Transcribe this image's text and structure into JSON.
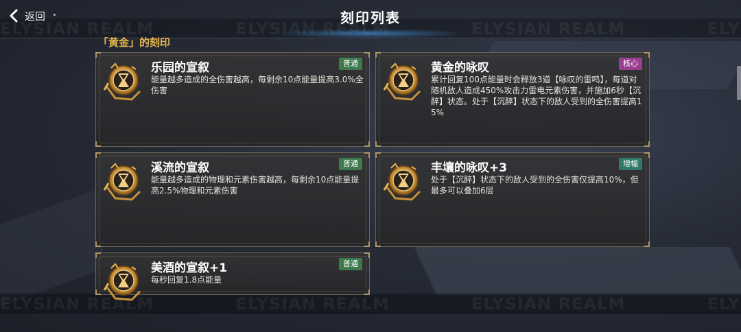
{
  "header": {
    "back_label": "返回",
    "title": "刻印列表"
  },
  "watermark": {
    "text": "ELYSIAN REALM"
  },
  "section": {
    "label": "「黄金」的刻印"
  },
  "colors": {
    "accent_gold": "#e8b64c",
    "badge_normal": "#3f7a4e",
    "badge_core": "#9a3f8f",
    "badge_boost": "#2f7a6a"
  },
  "cards": [
    {
      "name": "乐园的宣叙",
      "badge": "普通",
      "badge_type": "normal",
      "icon": "hourglass-cup-emblem-icon",
      "desc": "能量越多造成的全伤害越高，每剩余10点能量提高3.0%全伤害"
    },
    {
      "name": "黄金的咏叹",
      "badge": "核心",
      "badge_type": "core",
      "icon": "hourglass-cup-emblem-icon",
      "desc": "累计回复100点能量时会释放3道【咏叹的雷鸣】，每道对随机敌人造成450%攻击力雷电元素伤害，并施加6秒【沉醉】状态。处于【沉醉】状态下的敌人受到的全伤害提高15%"
    },
    {
      "name": "溪流的宣叙",
      "badge": "普通",
      "badge_type": "normal",
      "icon": "hourglass-cup-emblem-icon",
      "desc": "能量越多造成的物理和元素伤害越高，每剩余10点能量提高2.5%物理和元素伤害"
    },
    {
      "name": "丰壤的咏叹+3",
      "badge": "增幅",
      "badge_type": "boost",
      "icon": "hourglass-cup-emblem-icon",
      "desc": "处于【沉醉】状态下的敌人受到的全伤害仅提高10%，但最多可以叠加6层"
    },
    {
      "name": "美酒的宣叙+1",
      "badge": "普通",
      "badge_type": "normal",
      "icon": "hourglass-cup-emblem-icon",
      "desc": "每秒回复1.8点能量"
    }
  ]
}
